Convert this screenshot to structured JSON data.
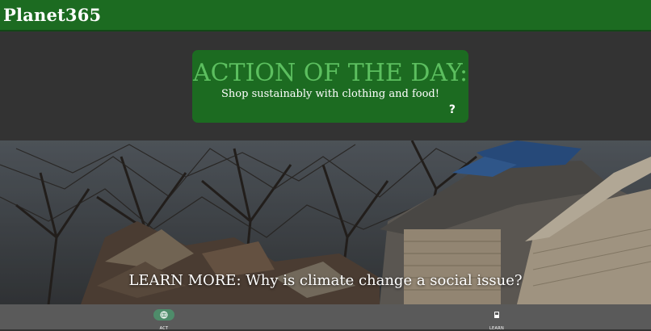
{
  "header": {
    "app_title": "Planet365"
  },
  "action_card": {
    "title": "ACTION OF THE DAY:",
    "description": "Shop sustainably with clothing and food!",
    "help_label": "?"
  },
  "hero": {
    "link_text": "LEARN MORE: Why is climate change a social issue?"
  },
  "bottom_nav": {
    "items": [
      {
        "label": "ACT",
        "icon": "globe-icon",
        "active": true
      },
      {
        "label": "LEARN",
        "icon": "book-icon",
        "active": false
      }
    ]
  },
  "colors": {
    "brand_green": "#1c6b21",
    "title_green": "#5cbf5f",
    "background": "#333333",
    "nav_bg": "#5a5a5a",
    "active_pill": "#4e8c6a"
  }
}
